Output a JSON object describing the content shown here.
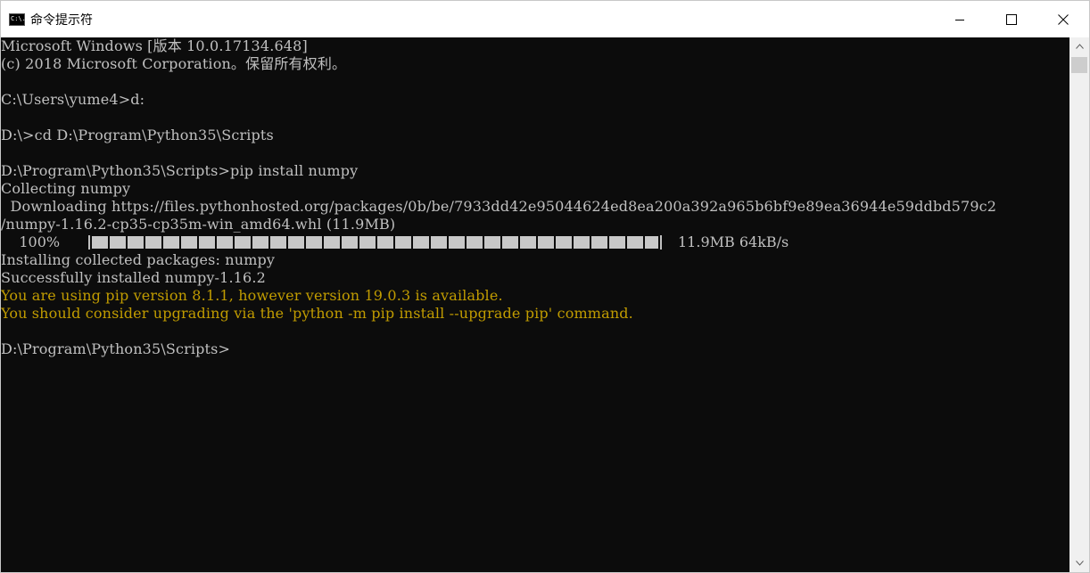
{
  "window": {
    "title": "命令提示符",
    "icon_label": "C:\\."
  },
  "controls": {
    "minimize_icon": "minimize-icon",
    "maximize_icon": "maximize-icon",
    "close_icon": "close-icon"
  },
  "console": {
    "lines": [
      "Microsoft Windows [版本 10.0.17134.648]",
      "(c) 2018 Microsoft Corporation。保留所有权利。",
      "",
      "C:\\Users\\yume4>d:",
      "",
      "D:\\>cd D:\\Program\\Python35\\Scripts",
      "",
      "D:\\Program\\Python35\\Scripts>pip install numpy",
      "Collecting numpy",
      "  Downloading https://files.pythonhosted.org/packages/0b/be/7933dd42e95044624ed8ea200a392a965b6bf9e89ea36944e59ddbd579c2",
      "/numpy-1.16.2-cp35-cp35m-win_amd64.whl (11.9MB)"
    ],
    "progress": {
      "percent_label": "    100%",
      "fraction": 1.0,
      "rate_label": "11.9MB 64kB/s"
    },
    "after_lines": [
      "Installing collected packages: numpy",
      "Successfully installed numpy-1.16.2"
    ],
    "warning_lines": [
      "You are using pip version 8.1.1, however version 19.0.3 is available.",
      "You should consider upgrading via the 'python -m pip install --upgrade pip' command."
    ],
    "prompt": "D:\\Program\\Python35\\Scripts>",
    "colors": {
      "text": "#c0c0c0",
      "warning": "#c19c00",
      "background": "#0c0c0c"
    }
  }
}
